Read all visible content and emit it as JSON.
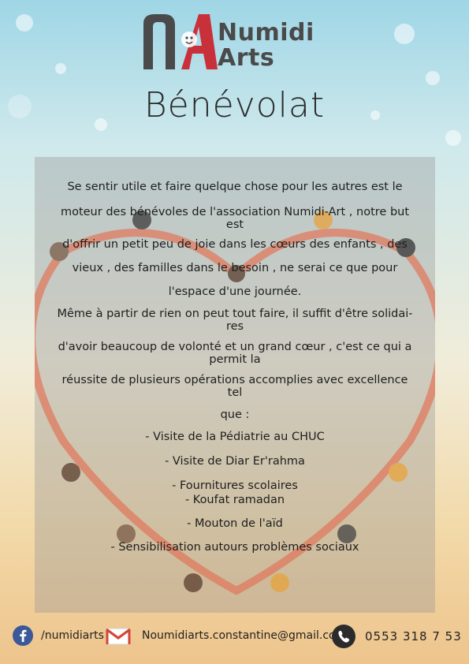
{
  "brand": {
    "logo_line1": "Numidi",
    "logo_line2": "Arts",
    "colors": {
      "brand_red": "#c8303a",
      "brand_gray": "#4a4a4a"
    }
  },
  "title": "Bénévolat",
  "body_lines": [
    "Se sentir utile et faire quelque chose pour les autres est le",
    "moteur des bénévoles de l'association Numidi-Art , notre but est",
    "d'offrir un petit peu de joie dans les cœurs des enfants , des",
    "vieux , des familles dans le besoin , ne serai ce que pour",
    "l'espace d'une journée.",
    "Même à partir de rien on peut tout faire, il suffit d'être solidai-res",
    "d'avoir beaucoup de volonté et un grand cœur , c'est ce qui a permit la",
    "réussite de plusieurs opérations accomplies avec excellence tel",
    "que :"
  ],
  "activities": [
    "- Visite de la Pédiatrie au CHUC",
    "- Visite de  Diar Er'rahma",
    "- Fournitures scolaires",
    "- Koufat ramadan",
    "- Mouton de l'aïd",
    "- Sensibilisation autours problèmes sociaux"
  ],
  "contacts": {
    "facebook": {
      "icon": "facebook-icon",
      "text": "/numidiarts"
    },
    "email": {
      "icon": "mail-icon",
      "text": "Noumidiarts.constantine@gmail.com"
    },
    "phone": {
      "icon": "phone-icon",
      "text": "0553 318 7 53"
    }
  }
}
